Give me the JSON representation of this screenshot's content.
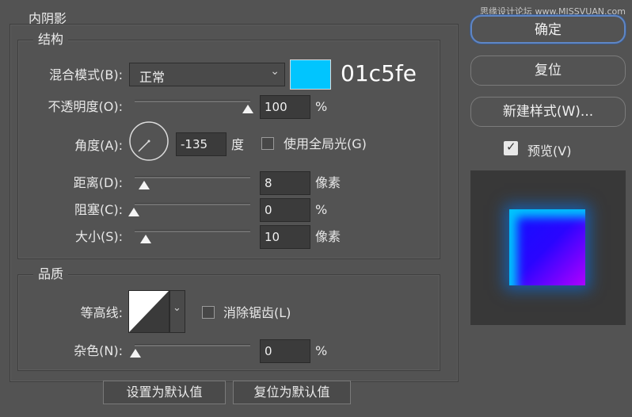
{
  "watermark": "思缘设计论坛 www.MISSVUAN.com",
  "dialog": {
    "section_title": "内阴影",
    "structure": {
      "title": "结构",
      "blend_mode_label": "混合模式(B):",
      "blend_mode_value": "正常",
      "color_hex_label": "01c5fe",
      "color_swatch": "#01c5fe",
      "opacity_label": "不透明度(O):",
      "opacity_value": "100",
      "opacity_unit": "%",
      "opacity_level": 100,
      "angle_label": "角度(A):",
      "angle_value": "-135",
      "angle_unit": "度",
      "global_light_label": "使用全局光(G)",
      "global_light_checked": false,
      "distance_label": "距离(D):",
      "distance_value": "8",
      "distance_unit": "像素",
      "choke_label": "阻塞(C):",
      "choke_value": "0",
      "choke_unit": "%",
      "size_label": "大小(S):",
      "size_value": "10",
      "size_unit": "像素"
    },
    "quality": {
      "title": "品质",
      "contour_label": "等高线:",
      "anti_alias_label": "消除锯齿(L)",
      "anti_alias_checked": false,
      "noise_label": "杂色(N):",
      "noise_value": "0",
      "noise_unit": "%"
    },
    "footer": {
      "make_default_label": "设置为默认值",
      "reset_default_label": "复位为默认值"
    }
  },
  "side": {
    "ok_label": "确定",
    "reset_label": "复位",
    "new_style_label": "新建样式(W)...",
    "preview_label": "预览(V)",
    "preview_checked": true
  }
}
